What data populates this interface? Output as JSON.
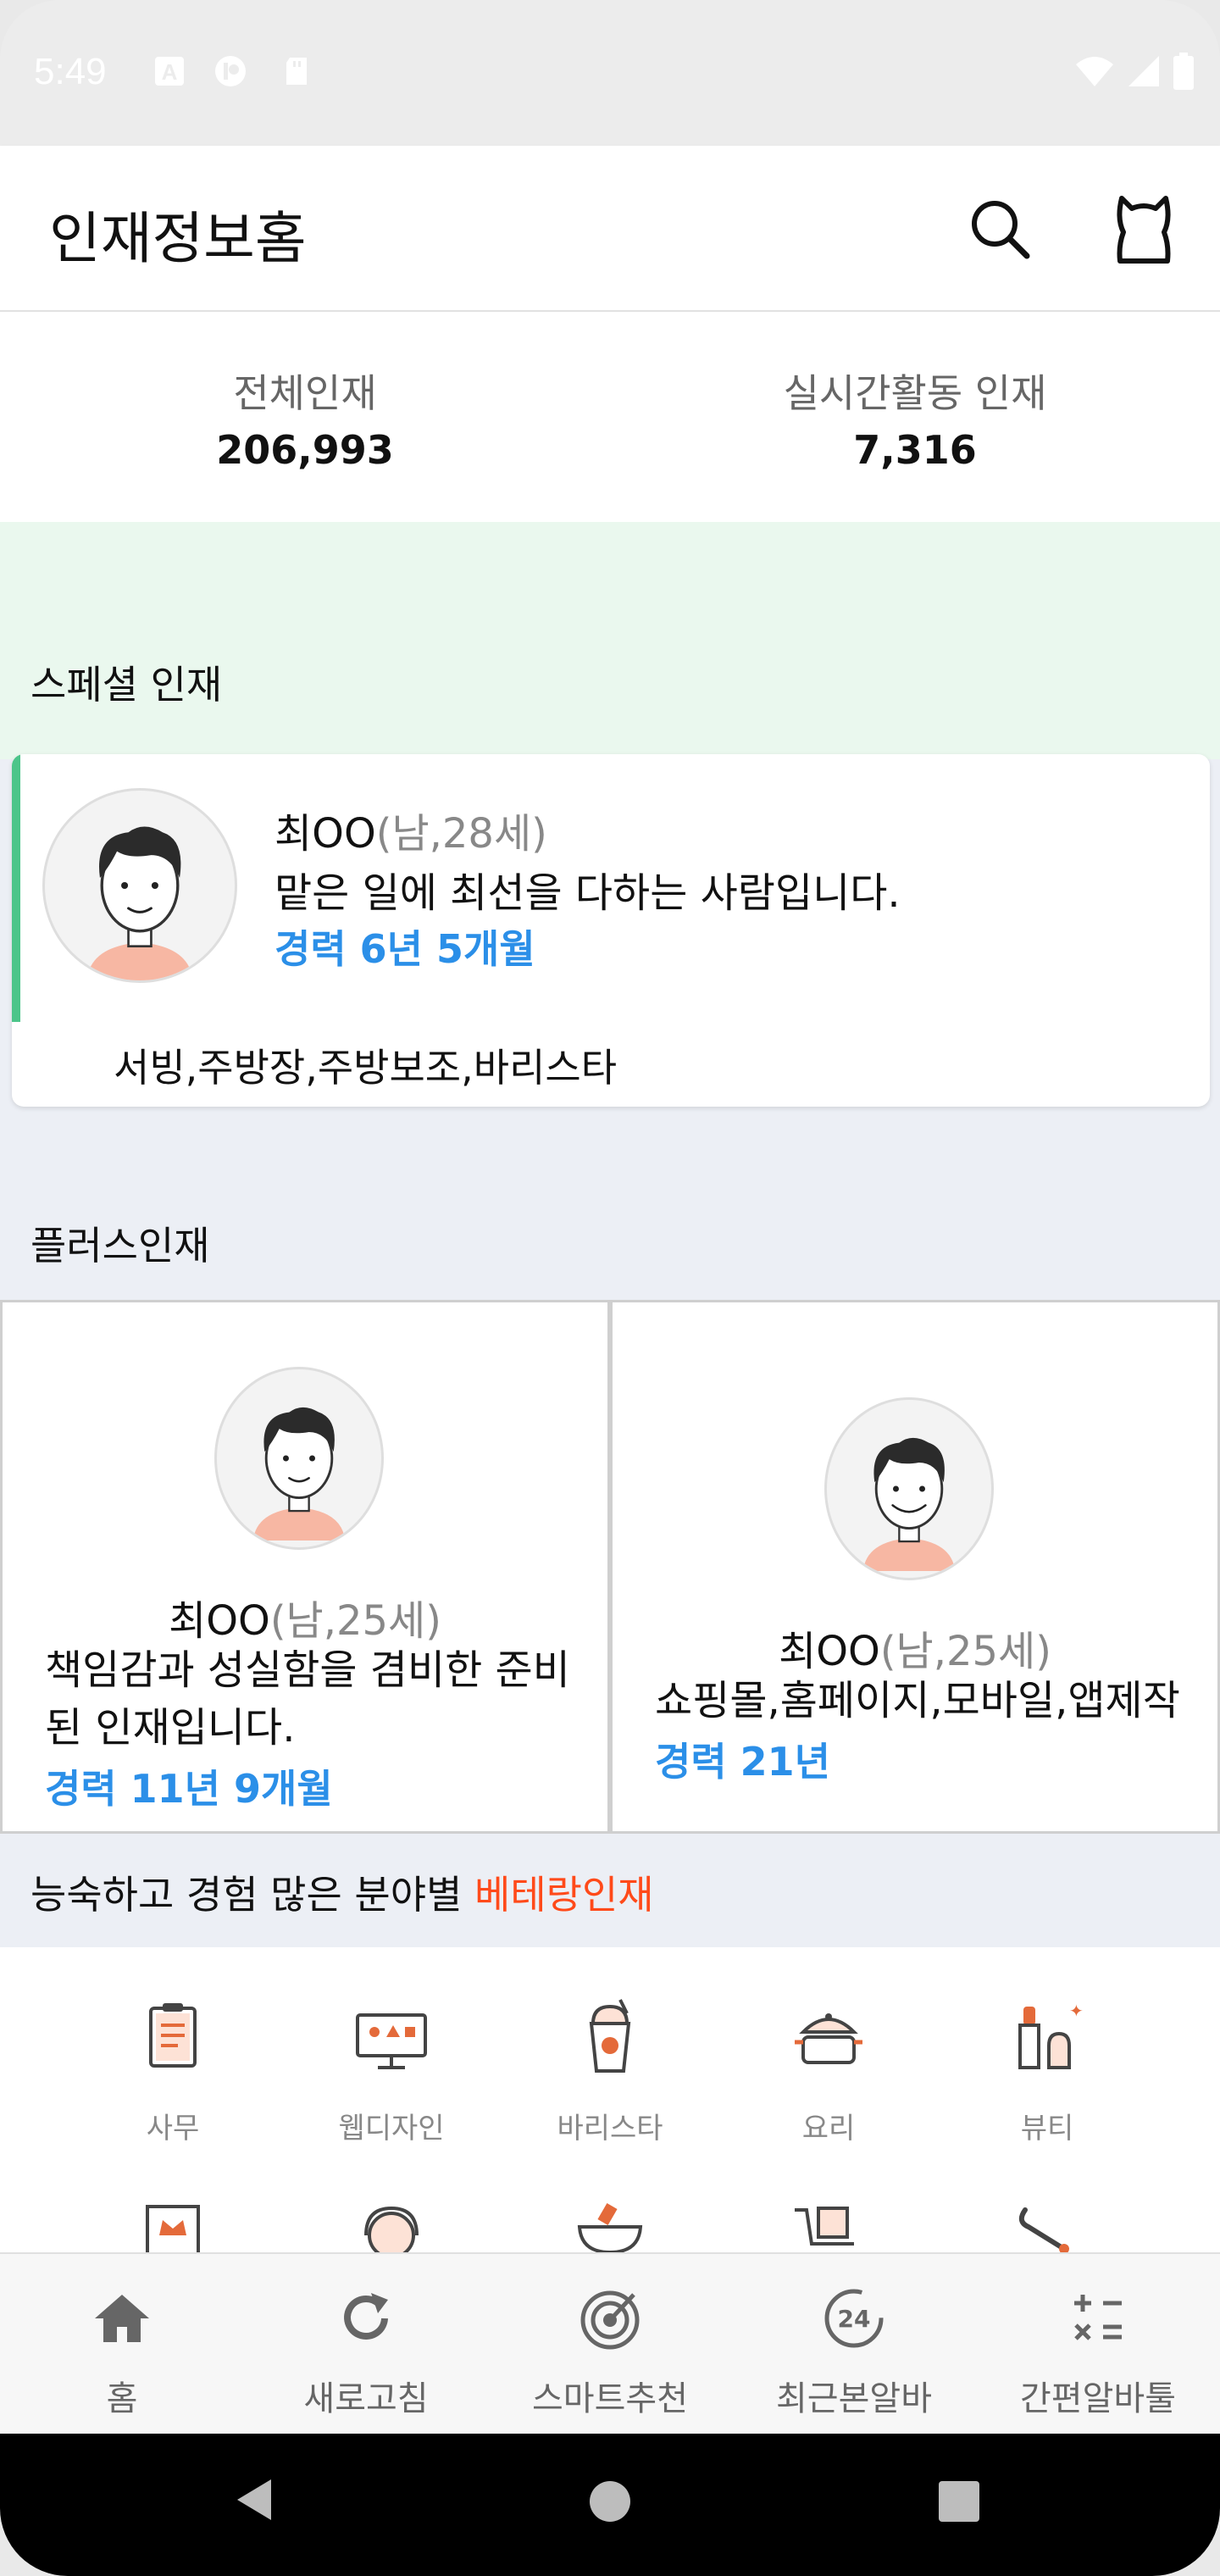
{
  "status_bar": {
    "time": "5:49"
  },
  "header": {
    "title": "인재정보홈"
  },
  "stats": [
    {
      "label": "전체인재",
      "value": "206,993"
    },
    {
      "label": "실시간활동 인재",
      "value": "7,316"
    }
  ],
  "special": {
    "title": "스페셜 인재",
    "name": "최OO",
    "meta": "(남,28세)",
    "intro": "맡은 일에 최선을 다하는 사람입니다.",
    "career": "경력 6년 5개월",
    "jobs": "서빙,주방장,주방보조,바리스타"
  },
  "plus": {
    "title": "플러스인재",
    "cards": [
      {
        "name": "최OO",
        "meta": "(남,25세)",
        "intro_line1": "책임감과 성실함을 겸비한 준비",
        "intro_line2": "된 인재입니다.",
        "career": "경력 11년 9개월"
      },
      {
        "name": "최OO",
        "meta": "(남,25세)",
        "intro_line1": "쇼핑몰,홈페이지,모바일,앱제작",
        "career": "경력 21년"
      }
    ]
  },
  "veteran": {
    "prefix": "능숙하고 경험 많은 분야별 ",
    "highlight": "베테랑인재"
  },
  "categories": [
    {
      "label": "사무",
      "icon": "document-icon"
    },
    {
      "label": "웹디자인",
      "icon": "monitor-icon"
    },
    {
      "label": "바리스타",
      "icon": "coffee-icon"
    },
    {
      "label": "요리",
      "icon": "pot-icon"
    },
    {
      "label": "뷰티",
      "icon": "cosmetics-icon"
    }
  ],
  "bottom_nav": [
    {
      "label": "홈",
      "icon": "home-icon"
    },
    {
      "label": "새로고침",
      "icon": "refresh-icon"
    },
    {
      "label": "스마트추천",
      "icon": "target-icon"
    },
    {
      "label": "최근본알바",
      "icon": "recent-24-icon"
    },
    {
      "label": "간편알바툴",
      "icon": "calculator-icon"
    }
  ],
  "colors": {
    "accent_green": "#4cc58a",
    "career_blue": "#2b8fe8",
    "highlight_orange": "#ff4a1a"
  }
}
